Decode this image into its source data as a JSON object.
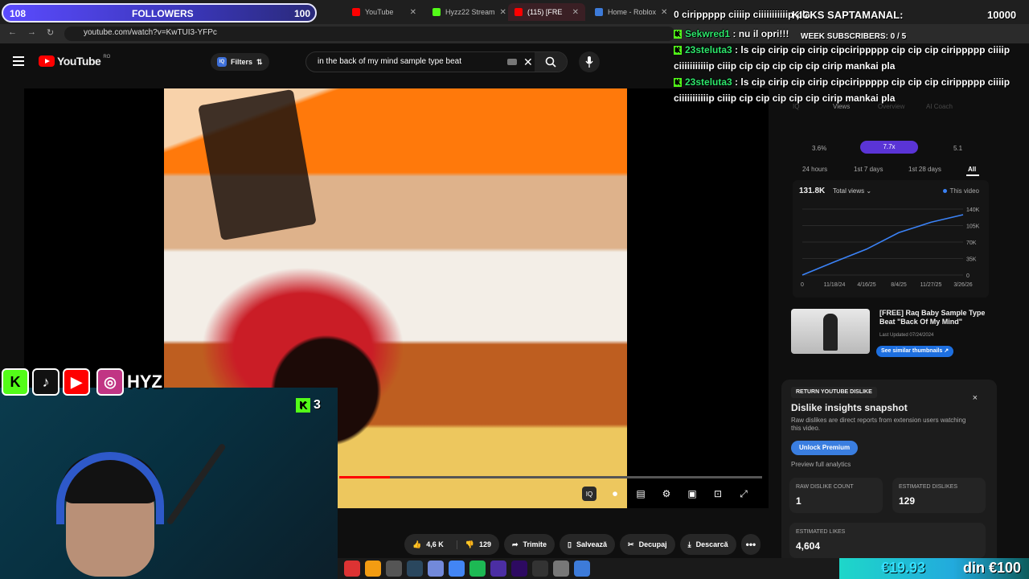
{
  "browser": {
    "tabs": [
      {
        "label": "YouTube",
        "color": "#ff0000"
      },
      {
        "label": "Hyzz22 Stream",
        "color": "#53fc18"
      },
      {
        "label": "(115) [FRE",
        "color": "#ff0000"
      },
      {
        "label": "Home - Roblox",
        "color": "#3d7bd9"
      }
    ],
    "url": "youtube.com/watch?v=KwTUI3-YFPc"
  },
  "youtube": {
    "logo_text": "YouTube",
    "region": "RO",
    "filters_label": "Filters",
    "filters_badge": "IQ",
    "search_value": "in the back of my mind sample type beat",
    "actions": {
      "likes": "4,6 K",
      "dislikes": "129",
      "share": "Trimite",
      "save": "Salvează",
      "clip": "Decupaj",
      "download": "Descarcă",
      "more": "•••"
    },
    "player_iq": "IQ"
  },
  "stream_overlay": {
    "followers_current": "108",
    "followers_label": "FOLLOWERS",
    "followers_goal": "100",
    "kicks_label": "KICKS SAPTAMANAL:",
    "kicks_count": "10000",
    "weekly_label": "WEEK SUBSCRIBERS: 0 / 5",
    "hyz_label": "HYZ",
    "cam_badge": "3",
    "donation_amount": "€19.93",
    "donation_goal": "din €100"
  },
  "chat": [
    {
      "user": "",
      "text": "0 cirippppp ciiiip ciiiiiiiiiiip pla",
      "shoes": 2
    },
    {
      "user": "Sekwred1",
      "text": ": nu il opri!!!",
      "shoes": 0
    },
    {
      "user": "23steluta3",
      "text": ": ls cip cirip cip cirip cipcirippppp cip cip cip cirippppp ciiiip ciiiiiiiiiiip ciiip cip cip cip cip cip cirip mankai pla",
      "shoes": 4
    },
    {
      "user": "23steluta3",
      "text": ": ls cip cirip cip cirip cipcirippppp cip cip cip cirippppp ciiiip ciiiiiiiiiiip ciiip cip cip cip cip cip cirip mankai pla",
      "shoes": 4
    }
  ],
  "vidiq": {
    "tabs": [
      "IQ",
      "Views",
      "Overview",
      "AI Coach"
    ],
    "stats": [
      "3.6%",
      "7.7x",
      "5.1"
    ],
    "ranges": [
      "24 hours",
      "1st 7 days",
      "1st 28 days",
      "All"
    ],
    "total": "131.8K",
    "metric": "Total views",
    "legend": "This video",
    "related_title": "[FREE] Raq Baby Sample Type Beat \"Back Of My Mind\"",
    "related_updated": "Last Updated 07/24/2024",
    "similar_button": "See similar thumbnails"
  },
  "chart_data": {
    "type": "line",
    "x": [
      "0",
      "11/18/24",
      "4/16/25",
      "8/4/25",
      "11/27/25",
      "3/26/26"
    ],
    "y_ticks": [
      "0",
      "35K",
      "70K",
      "105K",
      "140K"
    ],
    "ylim": [
      0,
      140000
    ],
    "series": [
      {
        "name": "This video",
        "values": [
          0,
          28000,
          55000,
          90000,
          112000,
          128000
        ]
      }
    ]
  },
  "dislike": {
    "badge": "RETURN YOUTUBE DISLIKE",
    "close": "×",
    "title": "Dislike insights snapshot",
    "description": "Raw dislikes are direct reports from extension users watching this video.",
    "unlock": "Unlock Premium",
    "preview": "Preview full analytics",
    "raw_label": "RAW DISLIKE COUNT",
    "raw_value": "1",
    "est_dislikes_label": "ESTIMATED DISLIKES",
    "est_dislikes_value": "129",
    "est_likes_label": "ESTIMATED LIKES",
    "est_likes_value": "4,604"
  }
}
